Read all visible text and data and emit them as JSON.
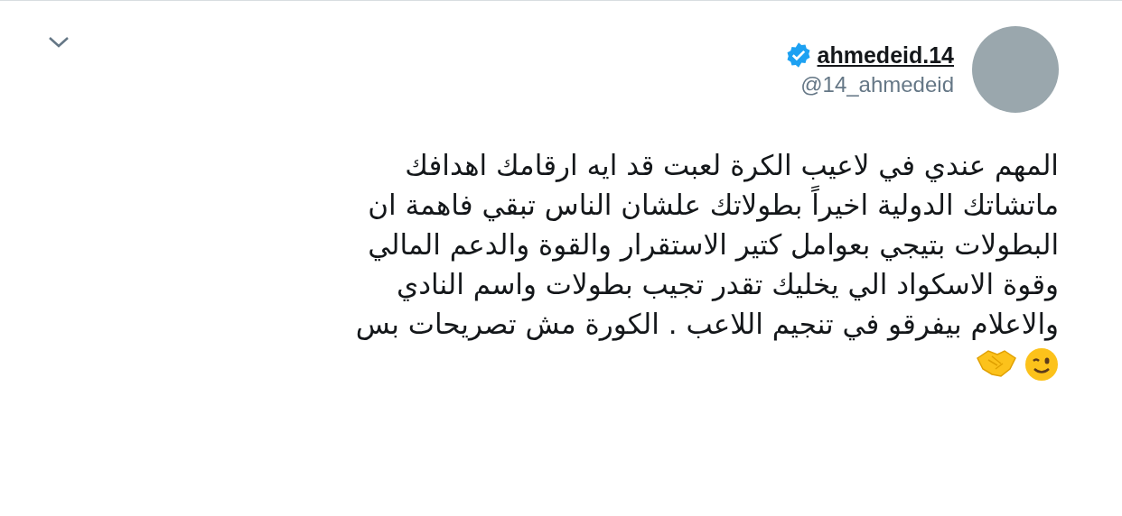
{
  "tweet": {
    "display_name": "ahmedeid.14",
    "verified": true,
    "handle": "@14_ahmedeid",
    "text": "المهم عندي في لاعيب الكرة لعبت قد ايه ارقامك اهدافك\nماتشاتك الدولية اخيراً بطولاتك علشان الناس تبقي فاهمة ان\nالبطولات بتيجي بعوامل كتير الاستقرار والقوة والدعم المالي\nوقوة الاسكواد الي يخليك تقدر تجيب بطولات واسم النادي\nوالاعلام بيفرقو في تنجيم اللاعب . الكورة مش تصريحات بس"
  }
}
